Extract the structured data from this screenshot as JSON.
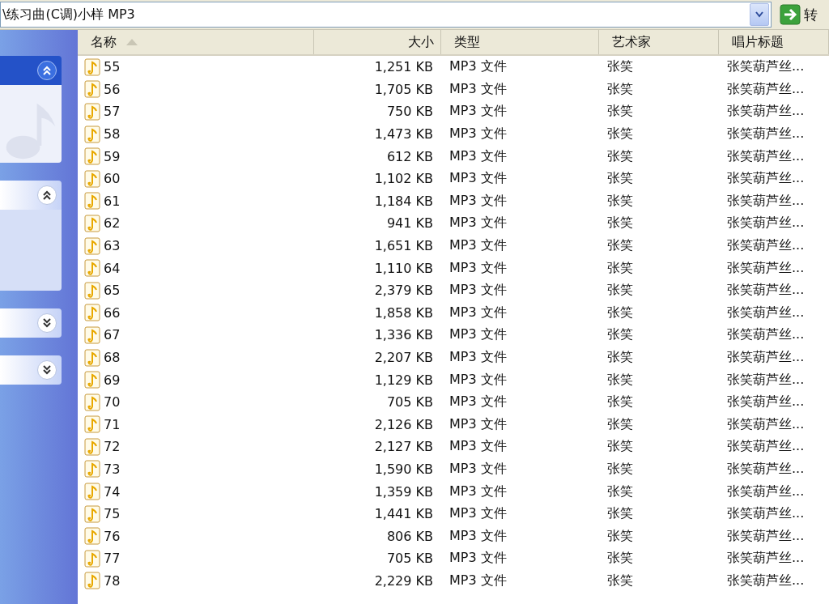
{
  "address_bar": {
    "value": "\\练习曲(C调)小样 MP3",
    "go_label": "转"
  },
  "task_panels": [
    {
      "kind": "special",
      "expanded": true
    },
    {
      "kind": "plain",
      "expanded": true
    },
    {
      "kind": "plain",
      "expanded": false
    },
    {
      "kind": "plain",
      "expanded": false
    }
  ],
  "table": {
    "columns": [
      {
        "label": "名称",
        "sorted": true
      },
      {
        "label": "大小",
        "sorted": false
      },
      {
        "label": "类型",
        "sorted": false
      },
      {
        "label": "艺术家",
        "sorted": false
      },
      {
        "label": "唱片标题",
        "sorted": false
      }
    ],
    "rows": [
      {
        "name": "55",
        "size": "1,251 KB",
        "type": "MP3 文件",
        "artist": "张笑",
        "album": "张笑葫芦丝..."
      },
      {
        "name": "56",
        "size": "1,705 KB",
        "type": "MP3 文件",
        "artist": "张笑",
        "album": "张笑葫芦丝..."
      },
      {
        "name": "57",
        "size": "750 KB",
        "type": "MP3 文件",
        "artist": "张笑",
        "album": "张笑葫芦丝..."
      },
      {
        "name": "58",
        "size": "1,473 KB",
        "type": "MP3 文件",
        "artist": "张笑",
        "album": "张笑葫芦丝..."
      },
      {
        "name": "59",
        "size": "612 KB",
        "type": "MP3 文件",
        "artist": "张笑",
        "album": "张笑葫芦丝..."
      },
      {
        "name": "60",
        "size": "1,102 KB",
        "type": "MP3 文件",
        "artist": "张笑",
        "album": "张笑葫芦丝..."
      },
      {
        "name": "61",
        "size": "1,184 KB",
        "type": "MP3 文件",
        "artist": "张笑",
        "album": "张笑葫芦丝..."
      },
      {
        "name": "62",
        "size": "941 KB",
        "type": "MP3 文件",
        "artist": "张笑",
        "album": "张笑葫芦丝..."
      },
      {
        "name": "63",
        "size": "1,651 KB",
        "type": "MP3 文件",
        "artist": "张笑",
        "album": "张笑葫芦丝..."
      },
      {
        "name": "64",
        "size": "1,110 KB",
        "type": "MP3 文件",
        "artist": "张笑",
        "album": "张笑葫芦丝..."
      },
      {
        "name": "65",
        "size": "2,379 KB",
        "type": "MP3 文件",
        "artist": "张笑",
        "album": "张笑葫芦丝..."
      },
      {
        "name": "66",
        "size": "1,858 KB",
        "type": "MP3 文件",
        "artist": "张笑",
        "album": "张笑葫芦丝..."
      },
      {
        "name": "67",
        "size": "1,336 KB",
        "type": "MP3 文件",
        "artist": "张笑",
        "album": "张笑葫芦丝..."
      },
      {
        "name": "68",
        "size": "2,207 KB",
        "type": "MP3 文件",
        "artist": "张笑",
        "album": "张笑葫芦丝..."
      },
      {
        "name": "69",
        "size": "1,129 KB",
        "type": "MP3 文件",
        "artist": "张笑",
        "album": "张笑葫芦丝..."
      },
      {
        "name": "70",
        "size": "705 KB",
        "type": "MP3 文件",
        "artist": "张笑",
        "album": "张笑葫芦丝..."
      },
      {
        "name": "71",
        "size": "2,126 KB",
        "type": "MP3 文件",
        "artist": "张笑",
        "album": "张笑葫芦丝..."
      },
      {
        "name": "72",
        "size": "2,127 KB",
        "type": "MP3 文件",
        "artist": "张笑",
        "album": "张笑葫芦丝..."
      },
      {
        "name": "73",
        "size": "1,590 KB",
        "type": "MP3 文件",
        "artist": "张笑",
        "album": "张笑葫芦丝..."
      },
      {
        "name": "74",
        "size": "1,359 KB",
        "type": "MP3 文件",
        "artist": "张笑",
        "album": "张笑葫芦丝..."
      },
      {
        "name": "75",
        "size": "1,441 KB",
        "type": "MP3 文件",
        "artist": "张笑",
        "album": "张笑葫芦丝..."
      },
      {
        "name": "76",
        "size": "806 KB",
        "type": "MP3 文件",
        "artist": "张笑",
        "album": "张笑葫芦丝..."
      },
      {
        "name": "77",
        "size": "705 KB",
        "type": "MP3 文件",
        "artist": "张笑",
        "album": "张笑葫芦丝..."
      },
      {
        "name": "78",
        "size": "2,229 KB",
        "type": "MP3 文件",
        "artist": "张笑",
        "album": "张笑葫芦丝..."
      }
    ]
  }
}
